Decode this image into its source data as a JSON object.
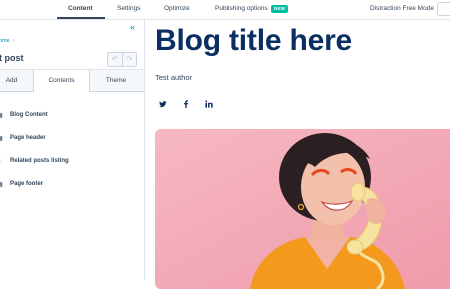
{
  "topnav": {
    "tabs": [
      {
        "label": "Content"
      },
      {
        "label": "Settings"
      },
      {
        "label": "Optimize"
      },
      {
        "label": "Publishing options"
      }
    ],
    "new_badge": "NEW",
    "distraction_free_label": "Distraction Free Mode"
  },
  "sidebar": {
    "collapse_icon": "double-chevron-left-icon",
    "breadcrumb": "ome",
    "page_name": "t post",
    "undo_icon": "undo-icon",
    "redo_icon": "redo-icon",
    "tabs": [
      {
        "label": "Add"
      },
      {
        "label": "Contents"
      },
      {
        "label": "Theme"
      }
    ],
    "active_tab": "Contents",
    "items": [
      {
        "label": "Blog Content",
        "icon": "module-icon"
      },
      {
        "label": "Page header",
        "icon": "module-icon"
      },
      {
        "label": "Related posts listing",
        "icon": "stack-icon"
      },
      {
        "label": "Page footer",
        "icon": "module-icon"
      }
    ]
  },
  "preview": {
    "title": "Blog title here",
    "author": "Test author",
    "social_icons": [
      "twitter-icon",
      "facebook-icon",
      "linkedin-icon"
    ],
    "hero_image": "woman-with-telephone-photo"
  },
  "colors": {
    "title": "#0b2e63",
    "text": "#33475b",
    "link": "#0091ae",
    "badge": "#00bda5",
    "hero_bg": "#f2a8b5"
  }
}
